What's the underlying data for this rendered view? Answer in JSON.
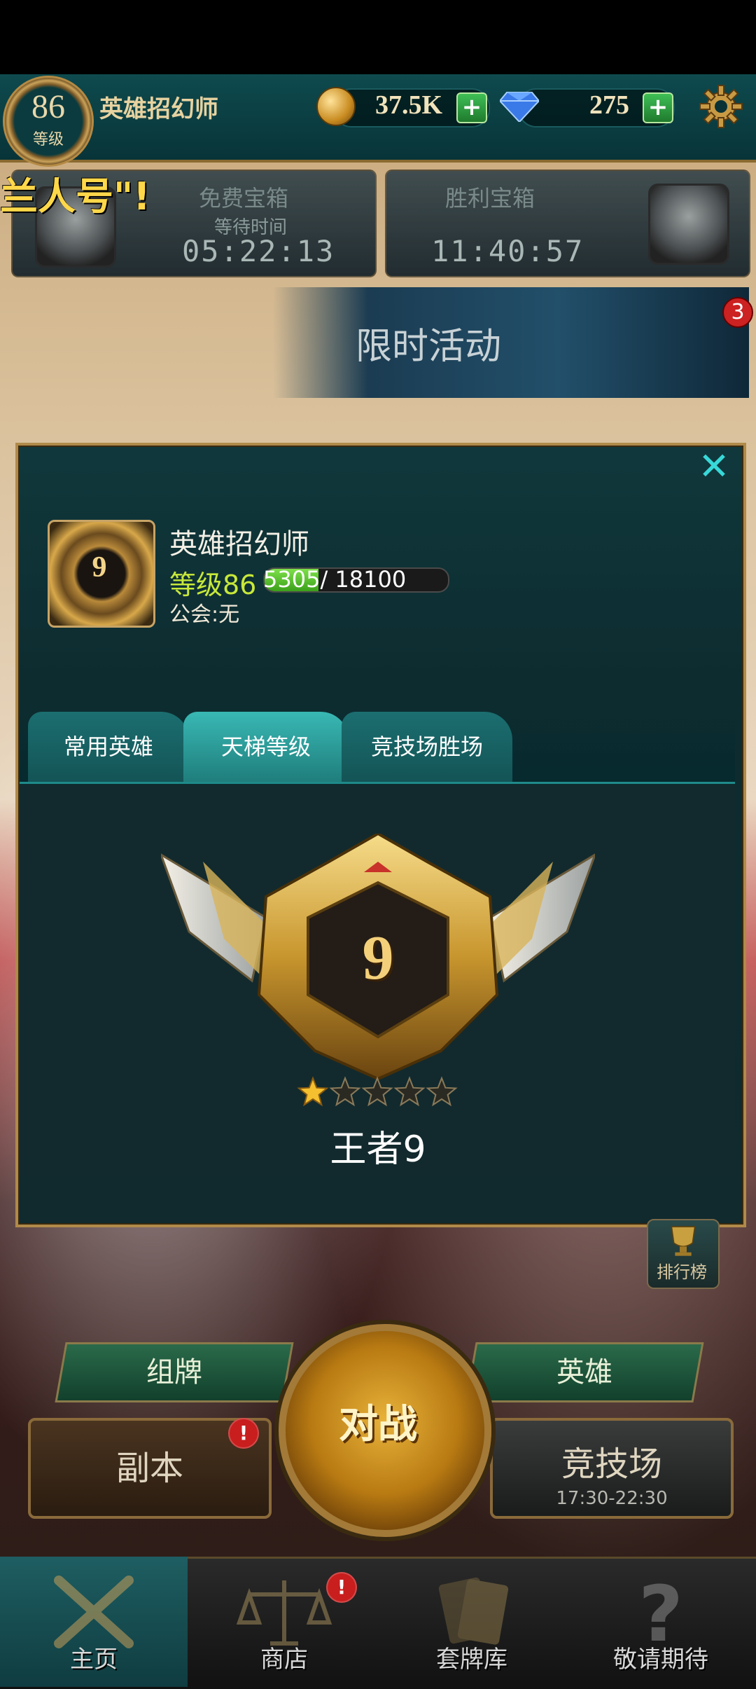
{
  "topbar": {
    "level": "86",
    "level_label": "等级",
    "player_name": "英雄招幻师",
    "coins": "37.5K",
    "gems": "275",
    "plus": "+"
  },
  "marquee": "兰人号\"!",
  "chests": [
    {
      "title": "免费宝箱",
      "subtitle": "等待时间",
      "time": "05:22:13"
    },
    {
      "title": "胜利宝箱",
      "subtitle": "",
      "time": "11:40:57"
    }
  ],
  "event": {
    "title": "限时活动",
    "badge": "3"
  },
  "modal": {
    "avatar_rank": "9",
    "name": "英雄招幻师",
    "level_text": "等级86",
    "xp_text": "5305/ 18100",
    "xp_fraction": 0.293,
    "guild": "公会:无",
    "close": "✕",
    "tabs": [
      "常用英雄",
      "天梯等级",
      "竞技场胜场"
    ],
    "active_tab": 1,
    "rank_number": "9",
    "rank_name": "王者9",
    "stars_total": 5,
    "stars_filled": 1
  },
  "leaderboard_label": "排行榜",
  "buttons": {
    "deck": "组牌",
    "heroes": "英雄",
    "fight": "对战",
    "dungeon": "副本",
    "arena": "竞技场",
    "arena_time": "17:30-22:30",
    "alert": "!"
  },
  "nav": [
    {
      "label": "主页",
      "icon": "crossed-swords-icon"
    },
    {
      "label": "商店",
      "icon": "scales-icon"
    },
    {
      "label": "套牌库",
      "icon": "cards-icon"
    },
    {
      "label": "敬请期待",
      "icon": "question-icon"
    }
  ],
  "colors": {
    "accent_teal": "#38d8d8",
    "gold": "#b08a4a",
    "level_yellow": "#c8e83a",
    "alert_red": "#c81e1e"
  }
}
